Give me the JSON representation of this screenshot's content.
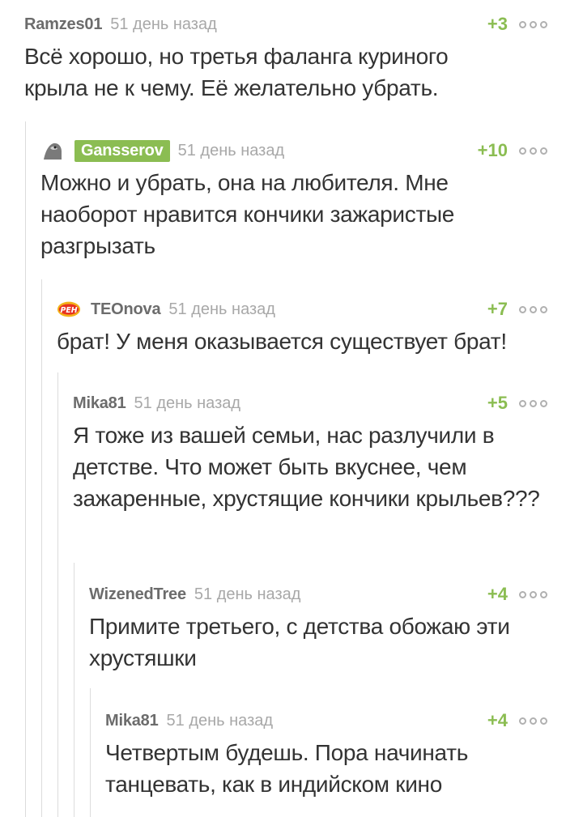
{
  "comments": [
    {
      "author": "Ramzes01",
      "date": "51 день назад",
      "rating": "+3",
      "text": "Всё хорошо, но третья фаланга куриного крыла не к чему. Её желательно убрать."
    },
    {
      "author": "Gansserov",
      "date": "51 день назад",
      "rating": "+10",
      "text": "Можно и убрать, она на любителя. Мне наоборот нравится кончики зажаристые разгрызать"
    },
    {
      "author": "TEOnova",
      "date": "51 день назад",
      "rating": "+7",
      "text": "брат! У меня оказывается существует брат!"
    },
    {
      "author": "Mika81",
      "date": "51 день назад",
      "rating": "+5",
      "text": "Я тоже из вашей семьи, нас разлучили в детстве. Что может быть вкуснее, чем зажаренные, хрустящие кончики крыльев???"
    },
    {
      "author": "WizenedTree",
      "date": "51 день назад",
      "rating": "+4",
      "text": "Примите третьего, с детства обожаю эти хрустяшки"
    },
    {
      "author": "Mika81",
      "date": "51 день назад",
      "rating": "+4",
      "text": "Четвертым будешь. Пора начинать танцевать, как в индийском кино"
    }
  ],
  "avatar_logo_text": "РЕН",
  "colors": {
    "rating": "#8bbd52",
    "author_highlight_bg": "#8bbd52",
    "author": "#6c6c6c",
    "date": "#a8a8a8",
    "text": "#333333"
  }
}
